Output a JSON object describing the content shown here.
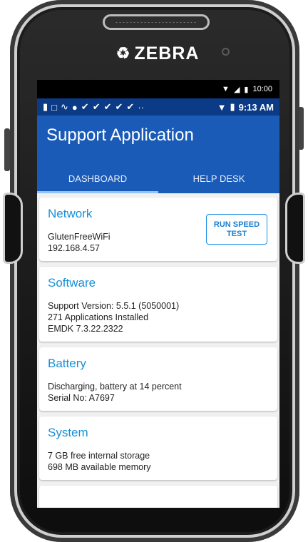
{
  "device": {
    "brand": "ZEBRA",
    "system_time": "10:00"
  },
  "status_bar": {
    "time": "9:13 AM"
  },
  "app": {
    "title": "Support Application"
  },
  "tabs": [
    {
      "label": "DASHBOARD",
      "active": true
    },
    {
      "label": "HELP DESK",
      "active": false
    }
  ],
  "cards": {
    "network": {
      "title": "Network",
      "lines": [
        "GlutenFreeWiFi",
        "192.168.4.57"
      ],
      "button_label": "RUN SPEED TEST"
    },
    "software": {
      "title": "Software",
      "lines": [
        "Support Version: 5.5.1 (5050001)",
        "271 Applications Installed",
        "EMDK 7.3.22.2322"
      ]
    },
    "battery": {
      "title": "Battery",
      "lines": [
        "Discharging, battery at 14 percent",
        "Serial No: A7697"
      ]
    },
    "system": {
      "title": "System",
      "lines": [
        "7 GB free internal storage",
        "698 MB available memory"
      ]
    }
  },
  "colors": {
    "status_bar": "#0b3b86",
    "app_bar": "#1a5bb8",
    "accent": "#1790d6"
  }
}
